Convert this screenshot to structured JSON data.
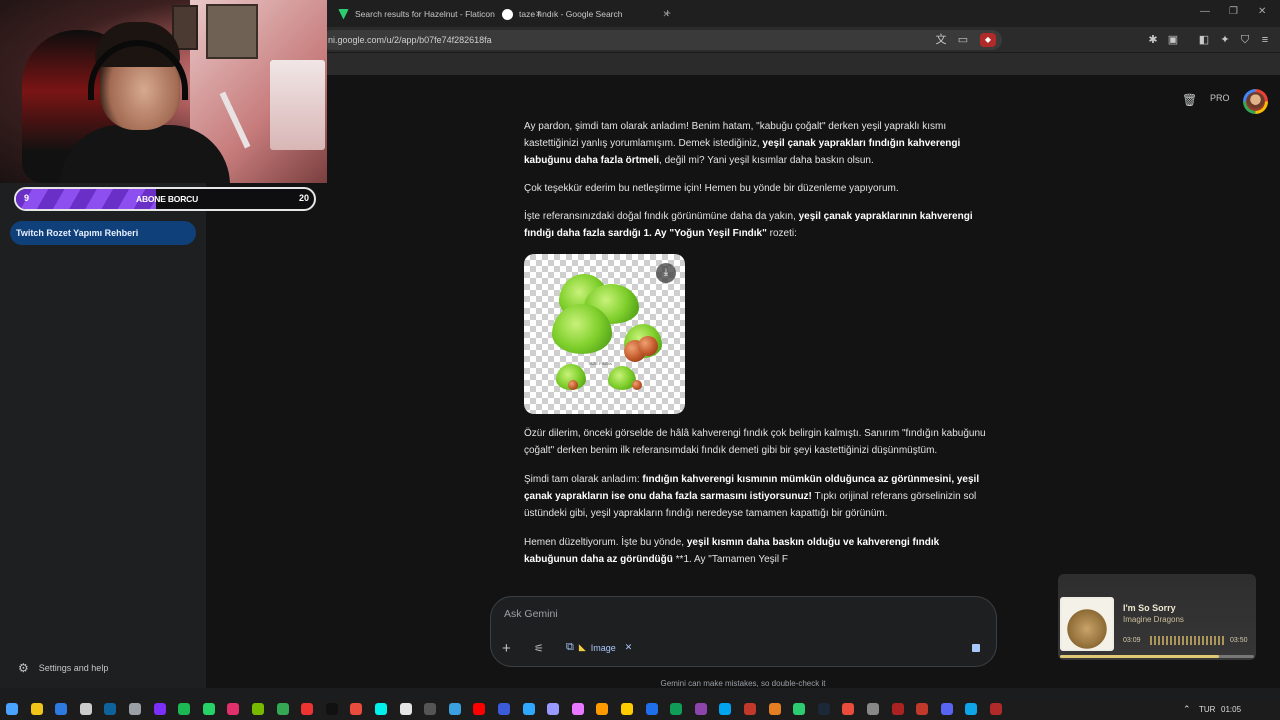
{
  "browser": {
    "tabs": [
      {
        "title": "Search results for Hazelnut - Flaticon",
        "color": "#2ecc71"
      },
      {
        "title": "taze fındık - Google Search",
        "color": "#ffffff"
      }
    ],
    "url": "ni.google.com/u/2/app/b07fe74f282618fa"
  },
  "overlay": {
    "sub_goal": {
      "current": "9",
      "label": "ABONE BORCU",
      "target": "20"
    }
  },
  "sidebar": {
    "active_chat": "Twitch Rozet Yapımı Rehberi",
    "settings_label": "Settings and help"
  },
  "header": {
    "pro_badge": "PRO"
  },
  "chat": {
    "p1_plain_a": "Ay pardon, şimdi tam olarak anladım! Benim hatam, \"kabuğu çoğalt\" derken yeşil yapraklı kısmı kastettiğinizi yanlış yorumlamışım. Demek istediğiniz, ",
    "p1_bold": "yeşil çanak yaprakları fındığın kahverengi kabuğunu daha fazla örtmeli",
    "p1_plain_b": ", değil mi? Yani yeşil kısımlar daha baskın olsun.",
    "p2": "Çok teşekkür ederim bu netleştirme için! Hemen bu yönde bir düzenleme yapıyorum.",
    "p3_plain_a": "İşte referansınızdaki doğal fındık görünümüne daha da yakın, ",
    "p3_bold": "yeşil çanak yapraklarının kahverengi fındığı daha fazla sardığı 1. Ay \"Yoğun Yeşil Fındık\"",
    "p3_plain_b": " rozeti:",
    "image_caption": "TAZE FINDIK",
    "p4": "Özür dilerim, önceki görselde de hâlâ kahverengi fındık çok belirgin kalmıştı. Sanırım \"fındığın kabuğunu çoğalt\" derken benim ilk referansımdaki fındık demeti gibi bir şeyi kastettiğinizi düşünmüştüm.",
    "p5_plain_a": "Şimdi tam olarak anladım: ",
    "p5_bold": "fındığın kahverengi kısmının mümkün olduğunca az görünmesini, yeşil çanak yaprakların ise onu daha fazla sarmasını istiyorsunuz!",
    "p5_plain_b": " Tıpkı orijinal referans görselinizin sol üstündeki gibi, yeşil yaprakların fındığı neredeyse tamamen kapattığı bir görünüm.",
    "p6_plain_a": "Hemen düzeltiyorum. İşte bu yönde, ",
    "p6_bold": "yeşil kısmın daha baskın olduğu ve kahverengi fındık kabuğunun daha az göründüğü",
    "p6_plain_b": " **1. Ay \"Tamamen Yeşil F"
  },
  "input": {
    "placeholder": "Ask Gemini",
    "chip_label": "Image",
    "disclaimer": "Gemini can make mistakes, so double-check it"
  },
  "music": {
    "title": "I'm So Sorry",
    "artist": "Imagine Dragons",
    "elapsed": "03:09",
    "duration": "03:50",
    "progress": 0.82
  },
  "taskbar": {
    "lang": "TUR",
    "time": "01:05"
  }
}
